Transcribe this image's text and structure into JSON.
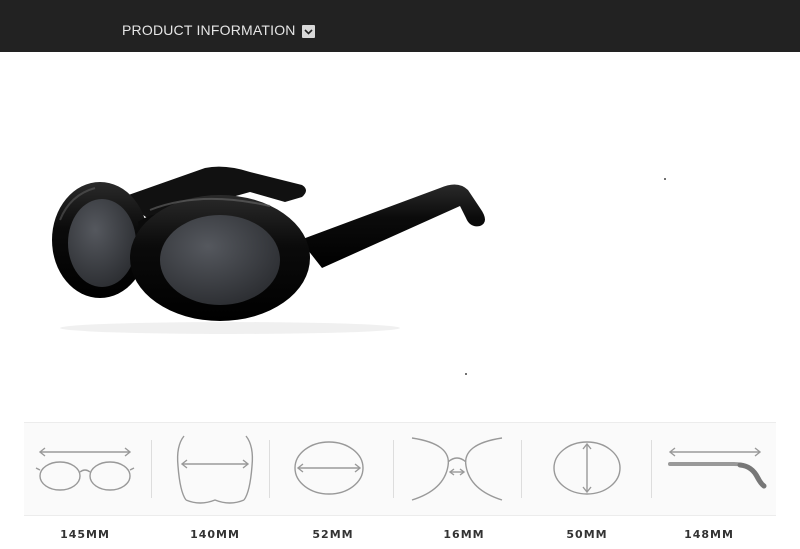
{
  "header": {
    "title": "PRODUCT INFORMATION",
    "icon": "chevron-down-icon",
    "background": "#222222"
  },
  "product": {
    "image": "black-oval-sunglasses",
    "frame_color": "#0d0d0d",
    "lens_color": "#3a3d42"
  },
  "specs": [
    {
      "icon": "total-width-icon",
      "value": "145MM"
    },
    {
      "icon": "frame-width-icon",
      "value": "140MM"
    },
    {
      "icon": "lens-width-icon",
      "value": "52MM"
    },
    {
      "icon": "bridge-width-icon",
      "value": "16MM"
    },
    {
      "icon": "lens-height-icon",
      "value": "50MM"
    },
    {
      "icon": "temple-length-icon",
      "value": "148MM"
    }
  ]
}
